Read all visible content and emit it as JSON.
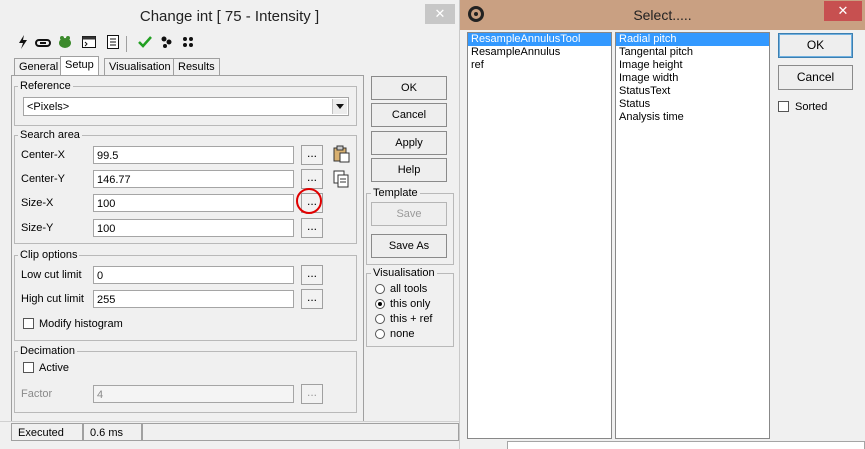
{
  "dialog": {
    "title": "Change int [ 75 - Intensity ]",
    "close_glyph": "✕",
    "toolbar_icons": [
      "lightning-icon",
      "link-icon",
      "frog-icon",
      "console-icon",
      "list-icon",
      "checkmark-icon",
      "footprint-icon",
      "dots-icon"
    ],
    "tabs": [
      {
        "label": "General",
        "active": false
      },
      {
        "label": "Setup",
        "active": true
      },
      {
        "label": "Visualisation",
        "active": false
      },
      {
        "label": "Results",
        "active": false
      }
    ],
    "reference": {
      "legend": "Reference",
      "selected": "<Pixels>"
    },
    "search_area": {
      "legend": "Search area",
      "rows": [
        {
          "label": "Center-X",
          "value": "99.5"
        },
        {
          "label": "Center-Y",
          "value": "146.77"
        },
        {
          "label": "Size-X",
          "value": "100"
        },
        {
          "label": "Size-Y",
          "value": "100"
        }
      ]
    },
    "clip_options": {
      "legend": "Clip options",
      "rows": [
        {
          "label": "Low cut limit",
          "value": "0"
        },
        {
          "label": "High cut limit",
          "value": "255"
        }
      ],
      "modify_histogram": "Modify histogram"
    },
    "decimation": {
      "legend": "Decimation",
      "active_label": "Active",
      "factor_label": "Factor",
      "factor_value": "4"
    },
    "ellipsis": "...",
    "buttons": {
      "ok": "OK",
      "cancel": "Cancel",
      "apply": "Apply",
      "help": "Help"
    },
    "template": {
      "legend": "Template",
      "save": "Save",
      "save_as": "Save As"
    },
    "visualisation": {
      "legend": "Visualisation",
      "options": [
        "all tools",
        "this only",
        "this + ref",
        "none"
      ],
      "selected_index": 1
    },
    "status": {
      "state": "Executed",
      "time": "0.6 ms"
    },
    "accent": "#e00000"
  },
  "select_dialog": {
    "title": "Select.....",
    "close_glyph": "✕",
    "left_items": [
      "ResampleAnnulusTool",
      "ResampleAnnulus",
      "ref"
    ],
    "left_selected": 0,
    "right_items": [
      "Radial pitch",
      "Tangental pitch",
      "Image height",
      "Image width",
      "StatusText",
      "Status",
      "Analysis time"
    ],
    "right_selected": 0,
    "ok": "OK",
    "cancel": "Cancel",
    "sorted": "Sorted",
    "titlebar_color": "#c9a082",
    "close_color": "#c75050",
    "selection_color": "#3399ff"
  }
}
